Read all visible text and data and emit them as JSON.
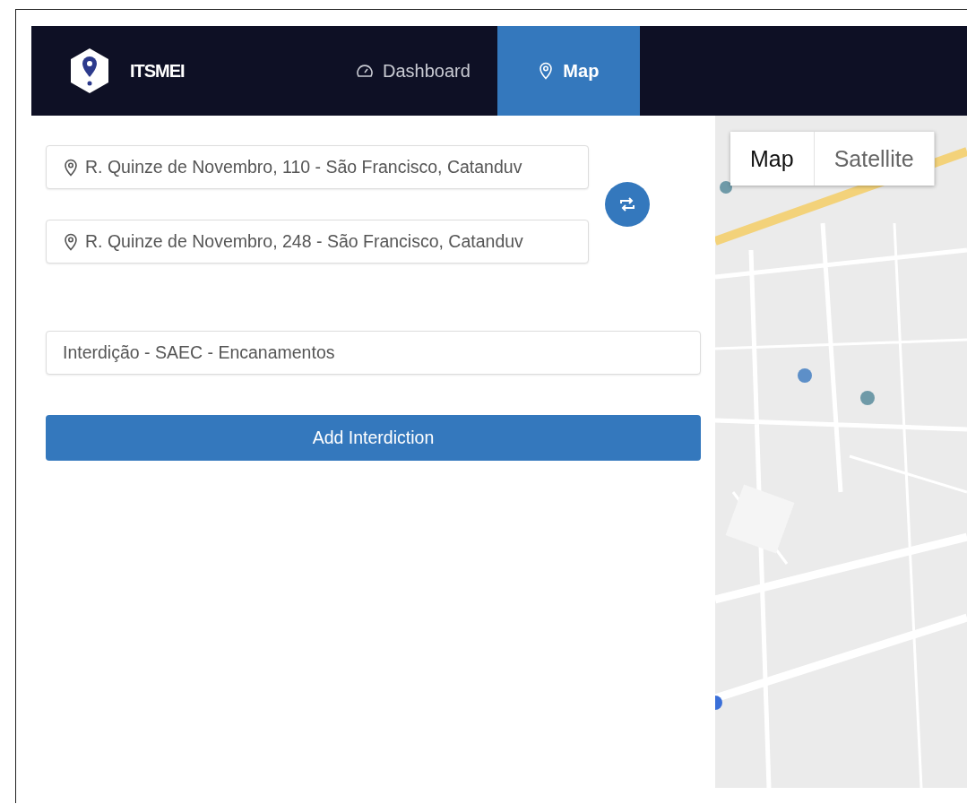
{
  "nav": {
    "brand": "ITSMEI",
    "tabs": [
      {
        "label": "Dashboard",
        "kind": "dashboard",
        "selected": false
      },
      {
        "label": "Map",
        "kind": "map",
        "selected": true
      }
    ]
  },
  "route": {
    "origin": "R. Quinze de Novembro, 110 - São Francisco, Catanduv",
    "destination": "R. Quinze de Novembro, 248 - São Francisco, Catanduv"
  },
  "interdiction": {
    "value": "Interdição - SAEC - Encanamentos"
  },
  "add_button": "Add Interdiction",
  "map": {
    "kind": "picture",
    "type_buttons": [
      {
        "label": "Map",
        "selected": true
      },
      {
        "label": "Satellite",
        "selected": false
      }
    ]
  }
}
